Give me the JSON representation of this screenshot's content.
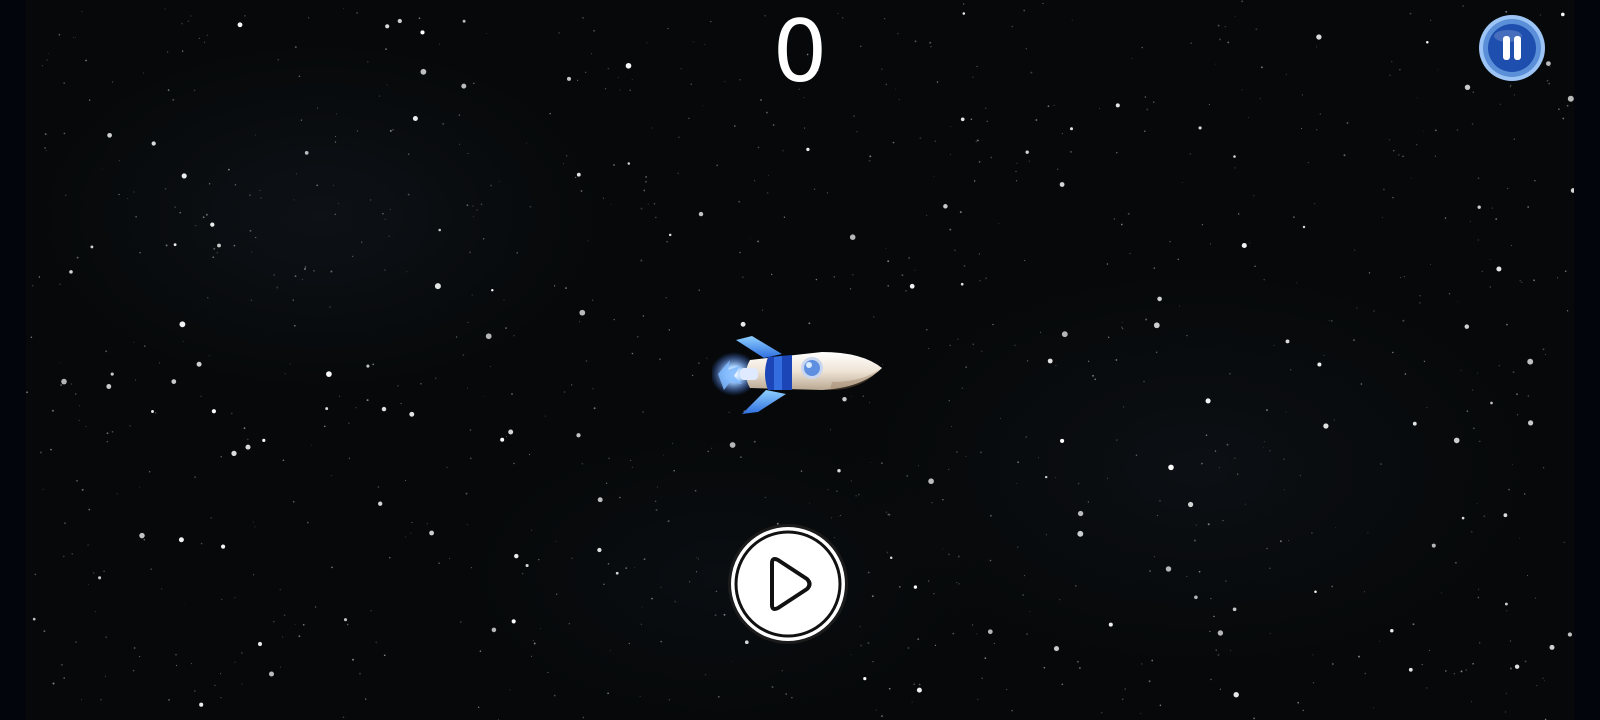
{
  "game": {
    "score": "0"
  },
  "controls": {
    "pause_icon": "pause-icon",
    "play_icon": "play-icon"
  },
  "colors": {
    "background": "#060809",
    "pause_ring": "#6fa3e6",
    "pause_fill": "#1e4fb3",
    "rocket_body": "#f2ebe2",
    "rocket_blue": "#1c45b8",
    "flame": "#5ea8ff"
  }
}
